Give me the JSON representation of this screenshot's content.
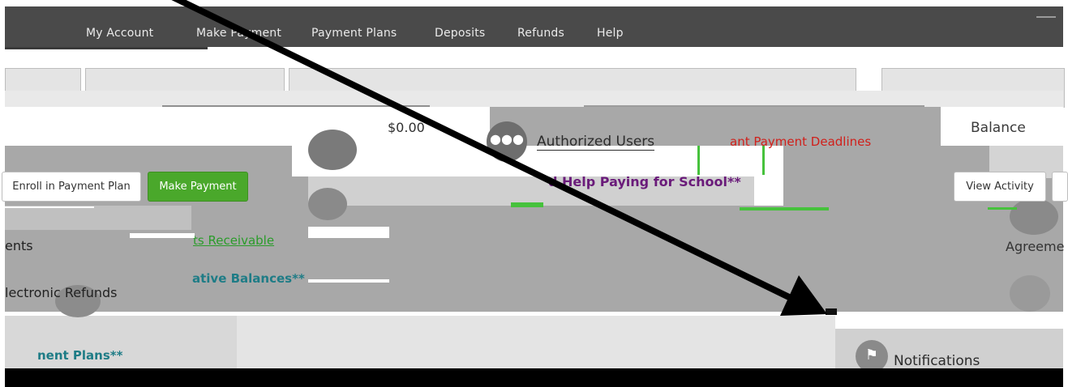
{
  "nav": {
    "items": [
      {
        "label": "My Account"
      },
      {
        "label": "Make Payment"
      },
      {
        "label": "Payment Plans"
      },
      {
        "label": "Deposits"
      },
      {
        "label": "Refunds"
      },
      {
        "label": "Help"
      }
    ]
  },
  "summary": {
    "amount": "$0.00",
    "balance_label": "Balance"
  },
  "links": {
    "authorized_users": "Authorized Users",
    "payment_deadlines": "ant Payment Deadlines",
    "help_paying": "d Help Paying for School**",
    "accounts_receivable": "ts Receivable",
    "negative_balances": "ative Balances**",
    "payment_plans": "nent Plans**",
    "notifications": "Notifications"
  },
  "buttons": {
    "enroll": "Enroll in Payment Plan",
    "make_payment": "Make Payment",
    "view_activity": "View Activity"
  },
  "labels": {
    "ents": "ents",
    "electronic_refunds": "lectronic Refunds",
    "agreement": "Agreeme"
  },
  "colors": {
    "nav_bg": "#4a4a4a",
    "primary_green": "#4aa82b",
    "deadline_red": "#d0201b",
    "help_purple": "#6a1b7a",
    "teal_link": "#1e7c86",
    "link_green": "#2a9c2a"
  },
  "icons": {
    "users": "users-icon",
    "flag": "flag-icon",
    "arrow": "annotation-arrow"
  }
}
